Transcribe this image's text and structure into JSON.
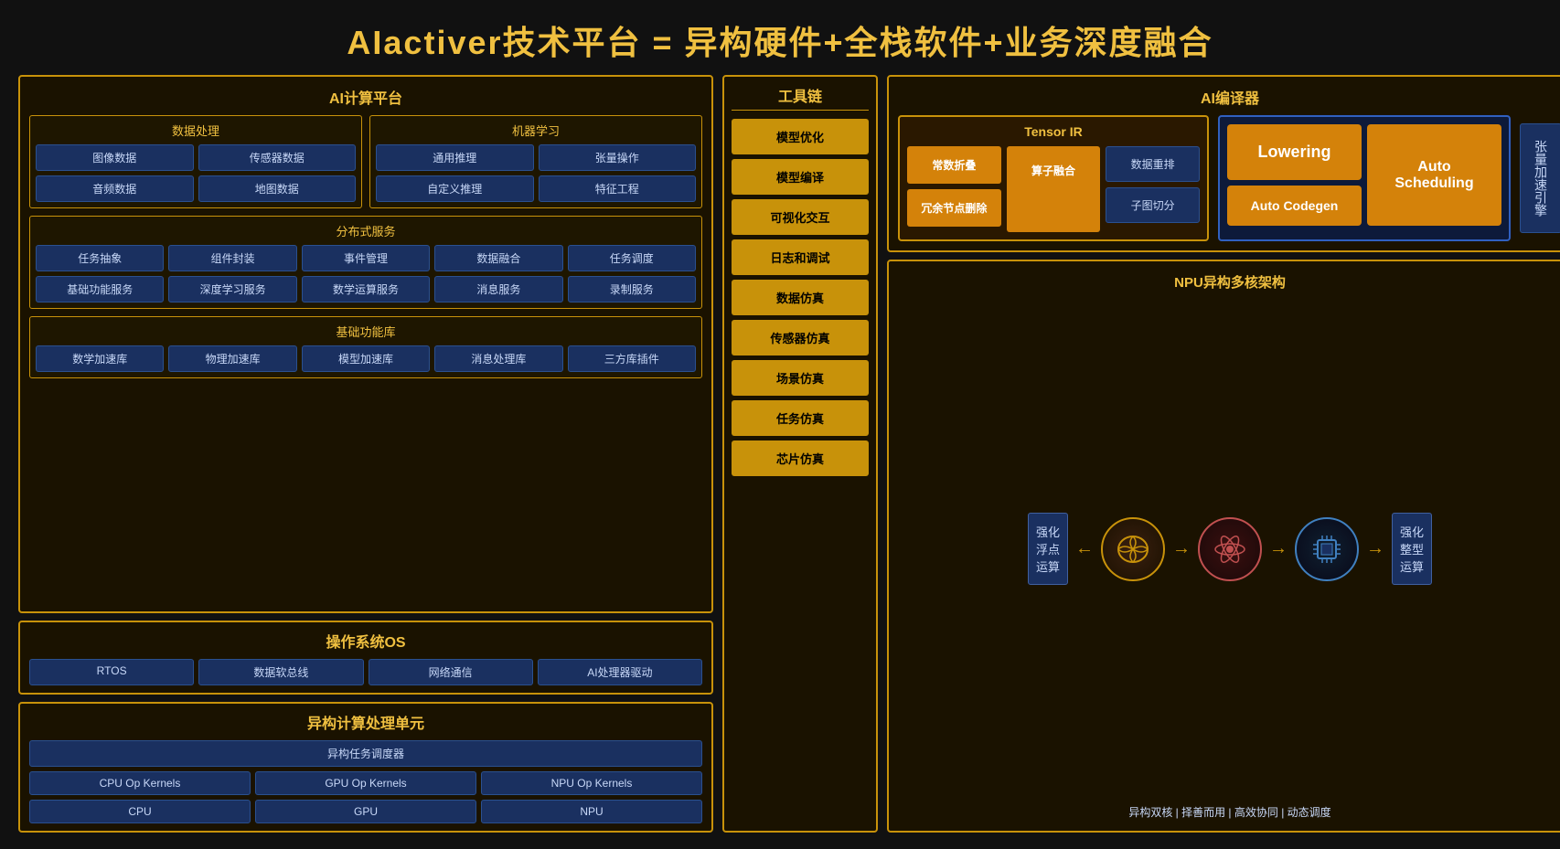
{
  "title": "AIactiver技术平台 = 异构硬件+全栈软件+业务深度融合",
  "left": {
    "ai_platform_title": "AI计算平台",
    "data_processing": {
      "title": "数据处理",
      "items": [
        "图像数据",
        "传感器数据",
        "音频数据",
        "地图数据"
      ]
    },
    "ml": {
      "title": "机器学习",
      "items": [
        "通用推理",
        "张量操作",
        "自定义推理",
        "特征工程"
      ]
    },
    "distributed": {
      "title": "分布式服务",
      "row1": [
        "任务抽象",
        "组件封装",
        "事件管理",
        "数据融合",
        "任务调度"
      ],
      "row2": [
        "基础功能服务",
        "深度学习服务",
        "数学运算服务",
        "消息服务",
        "录制服务"
      ]
    },
    "basic_lib": {
      "title": "基础功能库",
      "items": [
        "数学加速库",
        "物理加速库",
        "模型加速库",
        "消息处理库",
        "三方库插件"
      ]
    },
    "os": {
      "title": "操作系统OS",
      "items": [
        "RTOS",
        "数据软总线",
        "网络通信",
        "AI处理器驱动"
      ]
    },
    "hetero": {
      "title": "异构计算处理单元",
      "scheduler": "异构任务调度器",
      "kernels": [
        "CPU Op Kernels",
        "GPU Op Kernels",
        "NPU Op Kernels"
      ],
      "processors": [
        "CPU",
        "GPU",
        "NPU"
      ]
    }
  },
  "middle": {
    "title": "工具链",
    "items": [
      "模型优化",
      "模型编译",
      "可视化交互",
      "日志和调试",
      "数据仿真",
      "传感器仿真",
      "场景仿真",
      "任务仿真",
      "芯片仿真"
    ]
  },
  "right": {
    "compiler": {
      "title": "AI编译器",
      "tensor_ir": {
        "title": "Tensor IR",
        "items_left": [
          "常数折叠",
          "冗余节点删除"
        ],
        "items_middle": "算子融合",
        "items_right": [
          "数据重排",
          "子图切分"
        ]
      },
      "lowering": "Lowering",
      "auto_codegen": "Auto\nCodegen",
      "auto_scheduling": "Auto\nScheduling",
      "tensor_accel": "张量加速引擎"
    },
    "npu": {
      "title": "NPU异构多核架构",
      "left_box_line1": "强化",
      "left_box_line2": "浮点",
      "left_box_line3": "运算",
      "right_box_line1": "强化",
      "right_box_line2": "整型",
      "right_box_line3": "运算",
      "footer": "异构双核 | 择善而用 | 高效协同 | 动态调度",
      "sep1": "|",
      "sep2": "|",
      "sep3": "|"
    }
  }
}
